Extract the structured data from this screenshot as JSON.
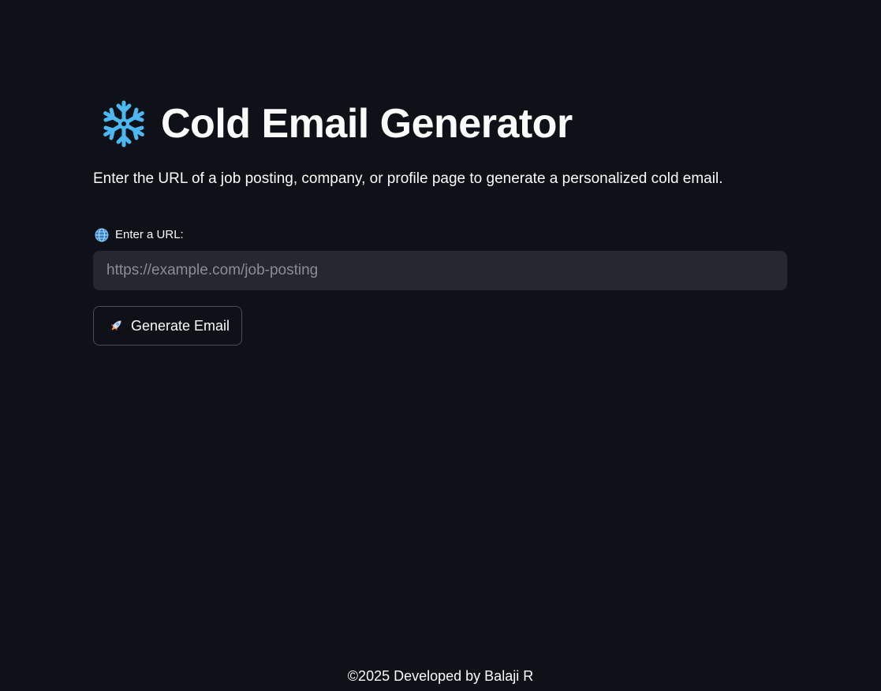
{
  "header": {
    "icon": "snowflake-icon",
    "title": "Cold Email Generator"
  },
  "description": "Enter the URL of a job posting, company, or profile page to generate a personalized cold email.",
  "url_field": {
    "icon": "globe-icon",
    "label": "Enter a URL:",
    "placeholder": "https://example.com/job-posting",
    "value": ""
  },
  "generate_button": {
    "icon": "rocket-icon",
    "label": "Generate Email"
  },
  "footer": {
    "text": "©2025 Developed by Balaji R"
  },
  "colors": {
    "background": "#0e1117",
    "input_background": "#262730",
    "text": "#fafafa",
    "placeholder": "#8b8d96",
    "accent_snowflake": "#4db8f0"
  }
}
